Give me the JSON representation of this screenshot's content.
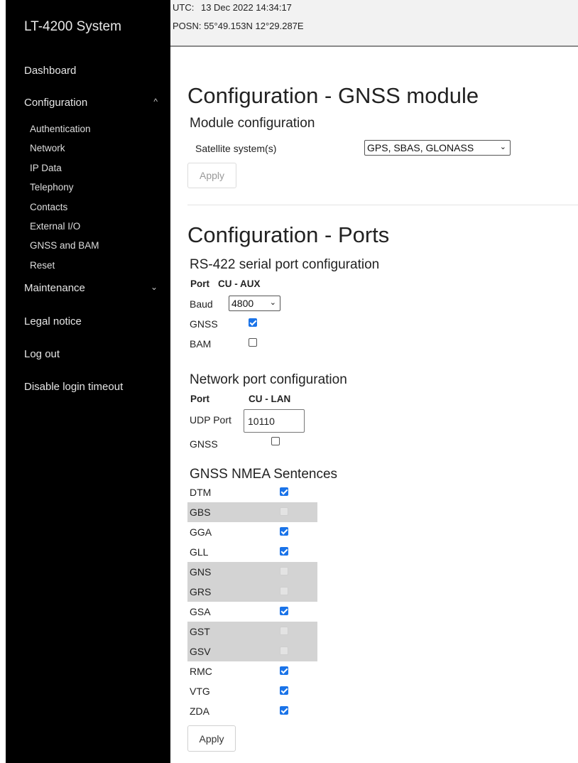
{
  "sidebar": {
    "brand": "LT-4200 System",
    "dashboard": "Dashboard",
    "configuration": "Configuration",
    "configuration_chevron": "^",
    "sub_items": [
      "Authentication",
      "Network",
      "IP Data",
      "Telephony",
      "Contacts",
      "External I/O",
      "GNSS and BAM",
      "Reset"
    ],
    "maintenance": "Maintenance",
    "maintenance_chevron": "⌄",
    "legal": "Legal notice",
    "logout": "Log out",
    "disable_timeout": "Disable login timeout"
  },
  "header": {
    "utc_label": "UTC:",
    "utc_value": "13 Dec 2022 14:34:17",
    "posn": "POSN: 55°49.153N 12°29.287E"
  },
  "gnss": {
    "title": "Configuration - GNSS module",
    "subtitle": "Module configuration",
    "satellite_label": "Satellite system(s)",
    "satellite_value": "GPS, SBAS, GLONASS",
    "apply_label": "Apply"
  },
  "ports": {
    "title": "Configuration - Ports",
    "rs422": {
      "subtitle": "RS-422 serial port configuration",
      "port_label": "Port",
      "port_value": "CU - AUX",
      "baud_label": "Baud",
      "baud_value": "4800",
      "gnss_label": "GNSS",
      "gnss_checked": true,
      "bam_label": "BAM",
      "bam_checked": false
    },
    "network": {
      "subtitle": "Network port configuration",
      "port_label": "Port",
      "port_value": "CU - LAN",
      "udp_label": "UDP Port",
      "udp_value": "10110",
      "gnss_label": "GNSS",
      "gnss_checked": false
    },
    "nmea": {
      "subtitle": "GNSS NMEA Sentences",
      "sentences": [
        {
          "name": "DTM",
          "state": "checked"
        },
        {
          "name": "GBS",
          "state": "disabled"
        },
        {
          "name": "GGA",
          "state": "checked"
        },
        {
          "name": "GLL",
          "state": "checked"
        },
        {
          "name": "GNS",
          "state": "disabled"
        },
        {
          "name": "GRS",
          "state": "disabled"
        },
        {
          "name": "GSA",
          "state": "checked"
        },
        {
          "name": "GST",
          "state": "disabled"
        },
        {
          "name": "GSV",
          "state": "disabled"
        },
        {
          "name": "RMC",
          "state": "checked"
        },
        {
          "name": "VTG",
          "state": "checked"
        },
        {
          "name": "ZDA",
          "state": "checked"
        }
      ]
    },
    "apply_label": "Apply"
  }
}
